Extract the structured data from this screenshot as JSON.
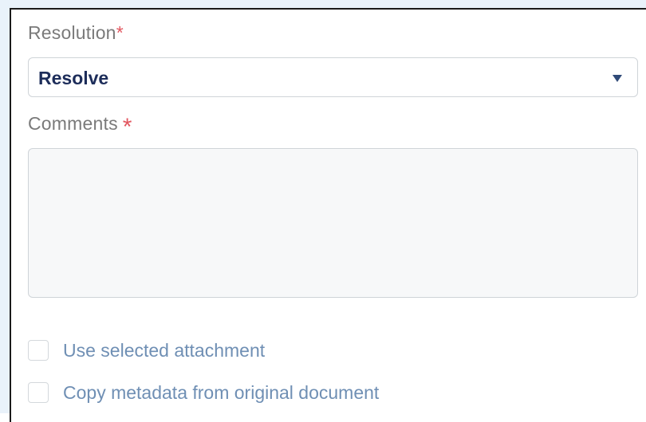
{
  "resolution": {
    "label": "Resolution",
    "required_marker": "*",
    "selected_value": "Resolve",
    "caret_icon": "triangle-down-icon"
  },
  "comments": {
    "label": "Comments",
    "required_marker": "*",
    "value": ""
  },
  "options": [
    {
      "label": "Use selected attachment",
      "checked": false
    },
    {
      "label": "Copy metadata from original document",
      "checked": false
    }
  ],
  "colors": {
    "required": "#e2565f",
    "select_text": "#1d2d5a",
    "option_text": "#6f8fb4",
    "label_text": "#7a7a7a"
  }
}
